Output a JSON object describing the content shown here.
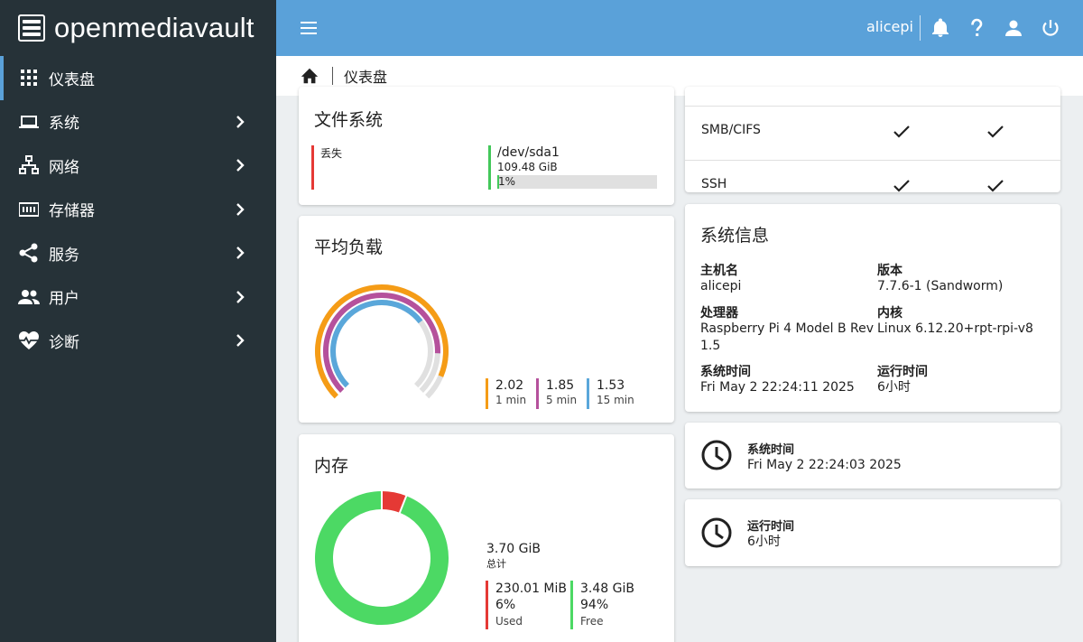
{
  "brand": {
    "name": "openmediavault"
  },
  "sidebar": {
    "items": [
      {
        "label": "仪表盘",
        "icon": "dashboard-grid-icon",
        "active": true,
        "has_children": false
      },
      {
        "label": "系统",
        "icon": "laptop-icon",
        "active": false,
        "has_children": true
      },
      {
        "label": "网络",
        "icon": "network-icon",
        "active": false,
        "has_children": true
      },
      {
        "label": "存储器",
        "icon": "storage-icon",
        "active": false,
        "has_children": true
      },
      {
        "label": "服务",
        "icon": "share-icon",
        "active": false,
        "has_children": true
      },
      {
        "label": "用户",
        "icon": "users-icon",
        "active": false,
        "has_children": true
      },
      {
        "label": "诊断",
        "icon": "heart-pulse-icon",
        "active": false,
        "has_children": true
      }
    ]
  },
  "topbar": {
    "username": "alicepi",
    "icons": [
      "menu-icon",
      "bell-icon",
      "help-icon",
      "user-icon",
      "power-icon"
    ]
  },
  "breadcrumb": {
    "current": "仪表盘"
  },
  "filesystems": {
    "title": "文件系统",
    "items": [
      {
        "name": "丢失",
        "status_color": "#e53935"
      },
      {
        "name": "/dev/sda1",
        "size": "109.48 GiB",
        "usage_label": "1%",
        "usage": 0.01,
        "status_color": "#43c85a"
      }
    ]
  },
  "load": {
    "title": "平均负载",
    "items": [
      {
        "value": "2.02",
        "label": "1 min",
        "color": "#f59c16",
        "numeric": 2.02
      },
      {
        "value": "1.85",
        "label": "5 min",
        "color": "#b5519c",
        "numeric": 1.85
      },
      {
        "value": "1.53",
        "label": "15 min",
        "color": "#5aa7da",
        "numeric": 1.53
      }
    ]
  },
  "memory": {
    "title": "内存",
    "total_value": "3.70 GiB",
    "total_label": "总计",
    "used": {
      "value": "230.01 MiB",
      "percent": "6%",
      "label": "Used",
      "color": "#e53935",
      "fraction": 0.06
    },
    "free": {
      "value": "3.48 GiB",
      "percent": "94%",
      "label": "Free",
      "color": "#4cd964",
      "fraction": 0.94
    }
  },
  "services": {
    "rows": [
      {
        "name": "SMB/CIFS",
        "enabled": true,
        "running": true
      },
      {
        "name": "SSH",
        "enabled": true,
        "running": true
      }
    ]
  },
  "sysinfo": {
    "title": "系统信息",
    "fields": {
      "hostname_label": "主机名",
      "hostname": "alicepi",
      "version_label": "版本",
      "version": "7.7.6-1 (Sandworm)",
      "cpu_label": "处理器",
      "cpu_line1": "Raspberry Pi 4 Model B Rev",
      "cpu_line2": "1.5",
      "kernel_label": "内核",
      "kernel": "Linux 6.12.20+rpt-rpi-v8",
      "time_label": "系统时间",
      "time": "Fri May 2 22:24:11 2025",
      "uptime_label": "运行时间",
      "uptime": "6小时"
    }
  },
  "time_widget": {
    "label": "系统时间",
    "value": "Fri May 2 22:24:03 2025"
  },
  "uptime_widget": {
    "label": "运行时间",
    "value": "6小时"
  }
}
